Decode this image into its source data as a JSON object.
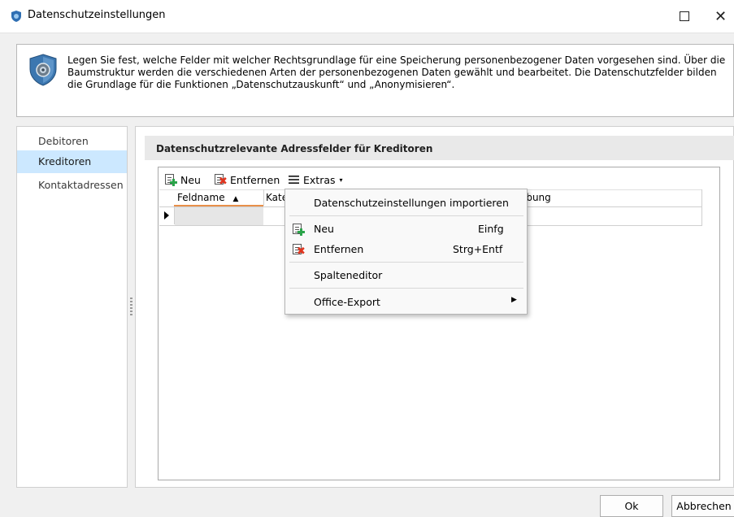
{
  "window": {
    "title": "Datenschutzeinstellungen",
    "maximize_glyph": "□",
    "close_glyph": "✕"
  },
  "info": {
    "text": "Legen Sie fest, welche Felder mit welcher Rechtsgrundlage für eine Speicherung personenbezogener Daten vorgesehen sind. Über die Baumstruktur werden die verschiedenen Arten der personenbezogenen Daten gewählt und bearbeitet. Die Datenschutzfelder bilden die Grundlage für die Funktionen „Datenschutzauskunft“ und „Anonymisieren“."
  },
  "nav": {
    "items": [
      {
        "label": "Debitoren",
        "selected": false
      },
      {
        "label": "Kreditoren",
        "selected": true
      },
      {
        "label": "Kontaktadressen",
        "selected": false
      }
    ]
  },
  "section": {
    "title": "Datenschutzrelevante Adressfelder für Kreditoren"
  },
  "toolbar": {
    "neu": "Neu",
    "entfernen": "Entfernen",
    "extras": "Extras",
    "extras_caret": "▾"
  },
  "grid": {
    "columns": [
      "Feldname",
      "Kate",
      "ibung"
    ],
    "sort_glyph": "▲"
  },
  "menu": {
    "import": "Datenschutzeinstellungen importieren",
    "neu": "Neu",
    "neu_shortcut": "Einfg",
    "entfernen": "Entfernen",
    "entfernen_shortcut": "Strg+Entf",
    "spalteneditor": "Spalteneditor",
    "office_export": "Office-Export",
    "submenu_arrow": "▶"
  },
  "buttons": {
    "ok": "Ok",
    "cancel": "Abbrechen"
  },
  "colors": {
    "selection": "#cce8ff",
    "sort_underline": "#e8904a",
    "add_green": "#2aa44a",
    "remove_red": "#e0341e"
  },
  "icons": [
    "shield-icon",
    "add-row-icon",
    "remove-row-icon",
    "menu-lines-icon",
    "row-pointer-icon"
  ]
}
